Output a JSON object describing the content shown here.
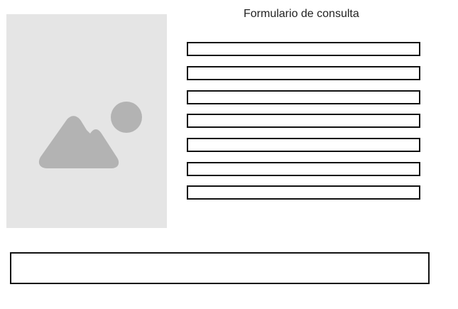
{
  "form": {
    "title": "Formulario de consulta"
  },
  "image": {
    "icon": "image-icon",
    "placeholder_color": "#e5e5e5",
    "icon_color": "#b3b3b3"
  },
  "fields": [
    {
      "value": ""
    },
    {
      "value": ""
    },
    {
      "value": ""
    },
    {
      "value": ""
    },
    {
      "value": ""
    },
    {
      "value": ""
    },
    {
      "value": ""
    }
  ],
  "bottom_box": {
    "text": ""
  }
}
